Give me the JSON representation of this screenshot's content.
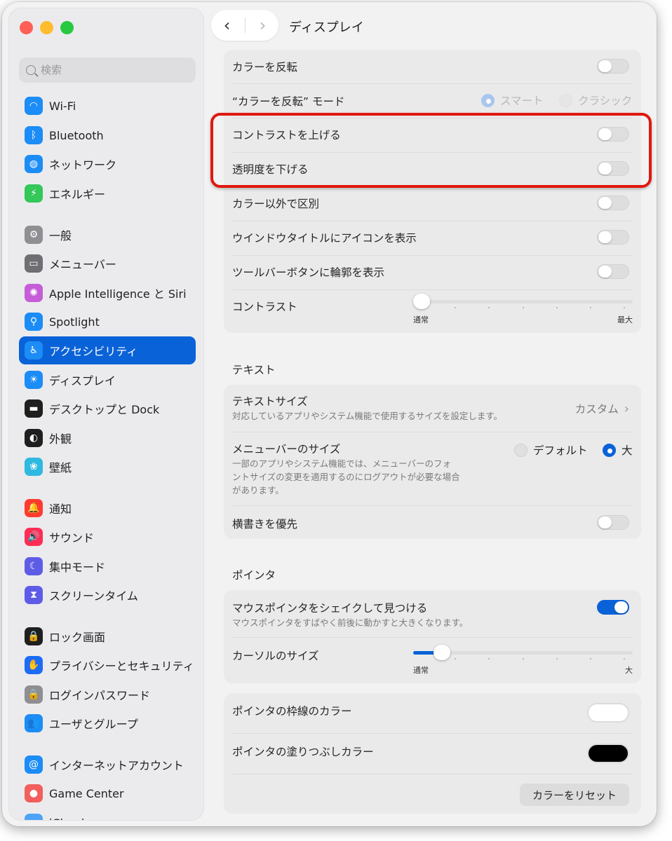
{
  "window": {
    "title": "ディスプレイ"
  },
  "sidebar": {
    "search_placeholder": "検索",
    "items": [
      {
        "label": "Wi-Fi",
        "icon": "wifi-icon",
        "color": "#1c8cf6",
        "glyph": "◠"
      },
      {
        "label": "Bluetooth",
        "icon": "bluetooth-icon",
        "color": "#1c8cf6",
        "glyph": "ᛒ"
      },
      {
        "label": "ネットワーク",
        "icon": "globe-icon",
        "color": "#1c8cf6",
        "glyph": "◍"
      },
      {
        "label": "エネルギー",
        "icon": "battery-icon",
        "color": "#34c759",
        "glyph": "⚡"
      },
      {
        "label": "一般",
        "icon": "gear-icon",
        "color": "#8e8e93",
        "glyph": "⚙"
      },
      {
        "label": "メニューバー",
        "icon": "menubar-icon",
        "color": "#6e6e73",
        "glyph": "▭"
      },
      {
        "label": "Apple Intelligence と Siri",
        "icon": "siri-icon",
        "color": "#c65cd8",
        "glyph": "✺"
      },
      {
        "label": "Spotlight",
        "icon": "spotlight-icon",
        "color": "#1c8cf6",
        "glyph": "⚲"
      },
      {
        "label": "アクセシビリティ",
        "icon": "accessibility-icon",
        "color": "#1c8cf6",
        "glyph": "♿"
      },
      {
        "label": "ディスプレイ",
        "icon": "display-icon",
        "color": "#1c8cf6",
        "glyph": "☀"
      },
      {
        "label": "デスクトップと Dock",
        "icon": "dock-icon",
        "color": "#1f1f1f",
        "glyph": "▬"
      },
      {
        "label": "外観",
        "icon": "appearance-icon",
        "color": "#1f1f1f",
        "glyph": "◐"
      },
      {
        "label": "壁紙",
        "icon": "wallpaper-icon",
        "color": "#2fb8e0",
        "glyph": "❀"
      },
      {
        "label": "通知",
        "icon": "bell-icon",
        "color": "#ff3b30",
        "glyph": "🔔"
      },
      {
        "label": "サウンド",
        "icon": "speaker-icon",
        "color": "#ff2d55",
        "glyph": "🔊"
      },
      {
        "label": "集中モード",
        "icon": "moon-icon",
        "color": "#5e5ce6",
        "glyph": "☾"
      },
      {
        "label": "スクリーンタイム",
        "icon": "hourglass-icon",
        "color": "#5e5ce6",
        "glyph": "⧗"
      },
      {
        "label": "ロック画面",
        "icon": "lock-icon",
        "color": "#1f1f1f",
        "glyph": "🔒"
      },
      {
        "label": "プライバシーとセキュリティ",
        "icon": "hand-icon",
        "color": "#1c6cf6",
        "glyph": "✋"
      },
      {
        "label": "ログインパスワード",
        "icon": "lock-icon",
        "color": "#8e8e93",
        "glyph": "🔒"
      },
      {
        "label": "ユーザとグループ",
        "icon": "users-icon",
        "color": "#1c8cf6",
        "glyph": "👥"
      },
      {
        "label": "インターネットアカウント",
        "icon": "at-icon",
        "color": "#1c8cf6",
        "glyph": "@"
      },
      {
        "label": "Game Center",
        "icon": "game-center-icon",
        "color": "#f25f5c",
        "glyph": "●"
      },
      {
        "label": "iCloud",
        "icon": "cloud-icon",
        "color": "#4fa3f7",
        "glyph": "☁"
      }
    ]
  },
  "display_group": {
    "invert_colors": "カラーを反転",
    "invert_mode": "“カラーを反転” モード",
    "mode_smart": "スマート",
    "mode_classic": "クラシック",
    "increase_contrast": "コントラストを上げる",
    "reduce_transparency": "透明度を下げる",
    "differentiate_without_color": "カラー以外で区別",
    "show_window_title_icons": "ウインドウタイトルにアイコンを表示",
    "show_toolbar_button_shapes": "ツールバーボタンに輪郭を表示",
    "contrast": "コントラスト",
    "contrast_min": "通常",
    "contrast_max": "最大",
    "contrast_level": 0.0
  },
  "text_section": {
    "title": "テキスト",
    "text_size": "テキストサイズ",
    "text_size_sub": "対応しているアプリやシステム機能で使用するサイズを設定します。",
    "text_size_value": "カスタム",
    "menubar_size": "メニューバーのサイズ",
    "menubar_size_sub_1": "一部のアプリやシステム機能では、メニューバーのフォ",
    "menubar_size_sub_2": "ントサイズの変更を適用するのにログアウトが必要な場合",
    "menubar_size_sub_3": "があります。",
    "size_default": "デフォルト",
    "size_large": "大",
    "prefer_horizontal": "横書きを優先"
  },
  "pointer_section": {
    "title": "ポインタ",
    "shake_to_locate": "マウスポインタをシェイクして見つける",
    "shake_to_locate_sub": "マウスポインタをすばやく前後に動かすと大きくなります。",
    "cursor_size": "カーソルのサイズ",
    "cursor_min": "通常",
    "cursor_max": "大",
    "cursor_level": 0.1
  },
  "pointer_color_group": {
    "outline_color": "ポインタの枠線のカラー",
    "fill_color": "ポインタの塗りつぶしカラー",
    "outline_color_value": "#ffffff",
    "fill_color_value": "#000000",
    "reset": "カラーをリセット"
  },
  "nav": {
    "back": "‹",
    "forward": "›"
  },
  "accent": "#0a62d8"
}
